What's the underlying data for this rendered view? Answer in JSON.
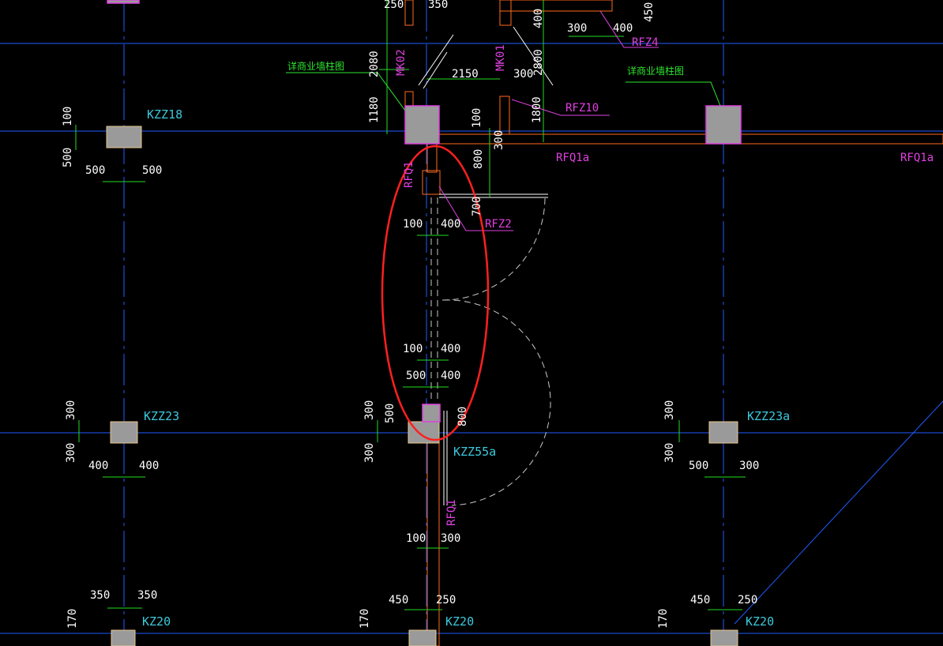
{
  "colors": {
    "background": "#000000",
    "axis_line": "#1f5cff",
    "dimension_line": "#22dd22",
    "column_fill": "#9a9a9a",
    "wall_outline": "#ff6a1a",
    "wall_hatch": "#cc3322",
    "label_cyan": "#3cc8dc",
    "label_magenta": "#e040e0",
    "note_green": "#2ee82e",
    "highlight_ellipse": "#ff2020"
  },
  "labels": {
    "kzz18": "KZZ18",
    "kzz23": "KZZ23",
    "kzz23a": "KZZ23a",
    "kzz55a": "KZZ55a",
    "kz20": "KZ20",
    "rfz4": "RFZ4",
    "rfz10": "RFZ10",
    "rfz2": "RFZ2",
    "rfq1a": "RFQ1a",
    "rfq1": "RFQ1",
    "mk02": "MK02",
    "mk01": "MK01",
    "note_detail": "详商业墙柱图"
  },
  "dims": {
    "d250": "250",
    "d350": "350",
    "d400": "400",
    "d300": "300",
    "d450": "450",
    "d2080": "2080",
    "d2150": "2150",
    "d2800": "2800",
    "d100": "100",
    "d500": "500",
    "d1180": "1180",
    "d1800": "1800",
    "d800": "800",
    "d700": "700",
    "d170": "170"
  }
}
